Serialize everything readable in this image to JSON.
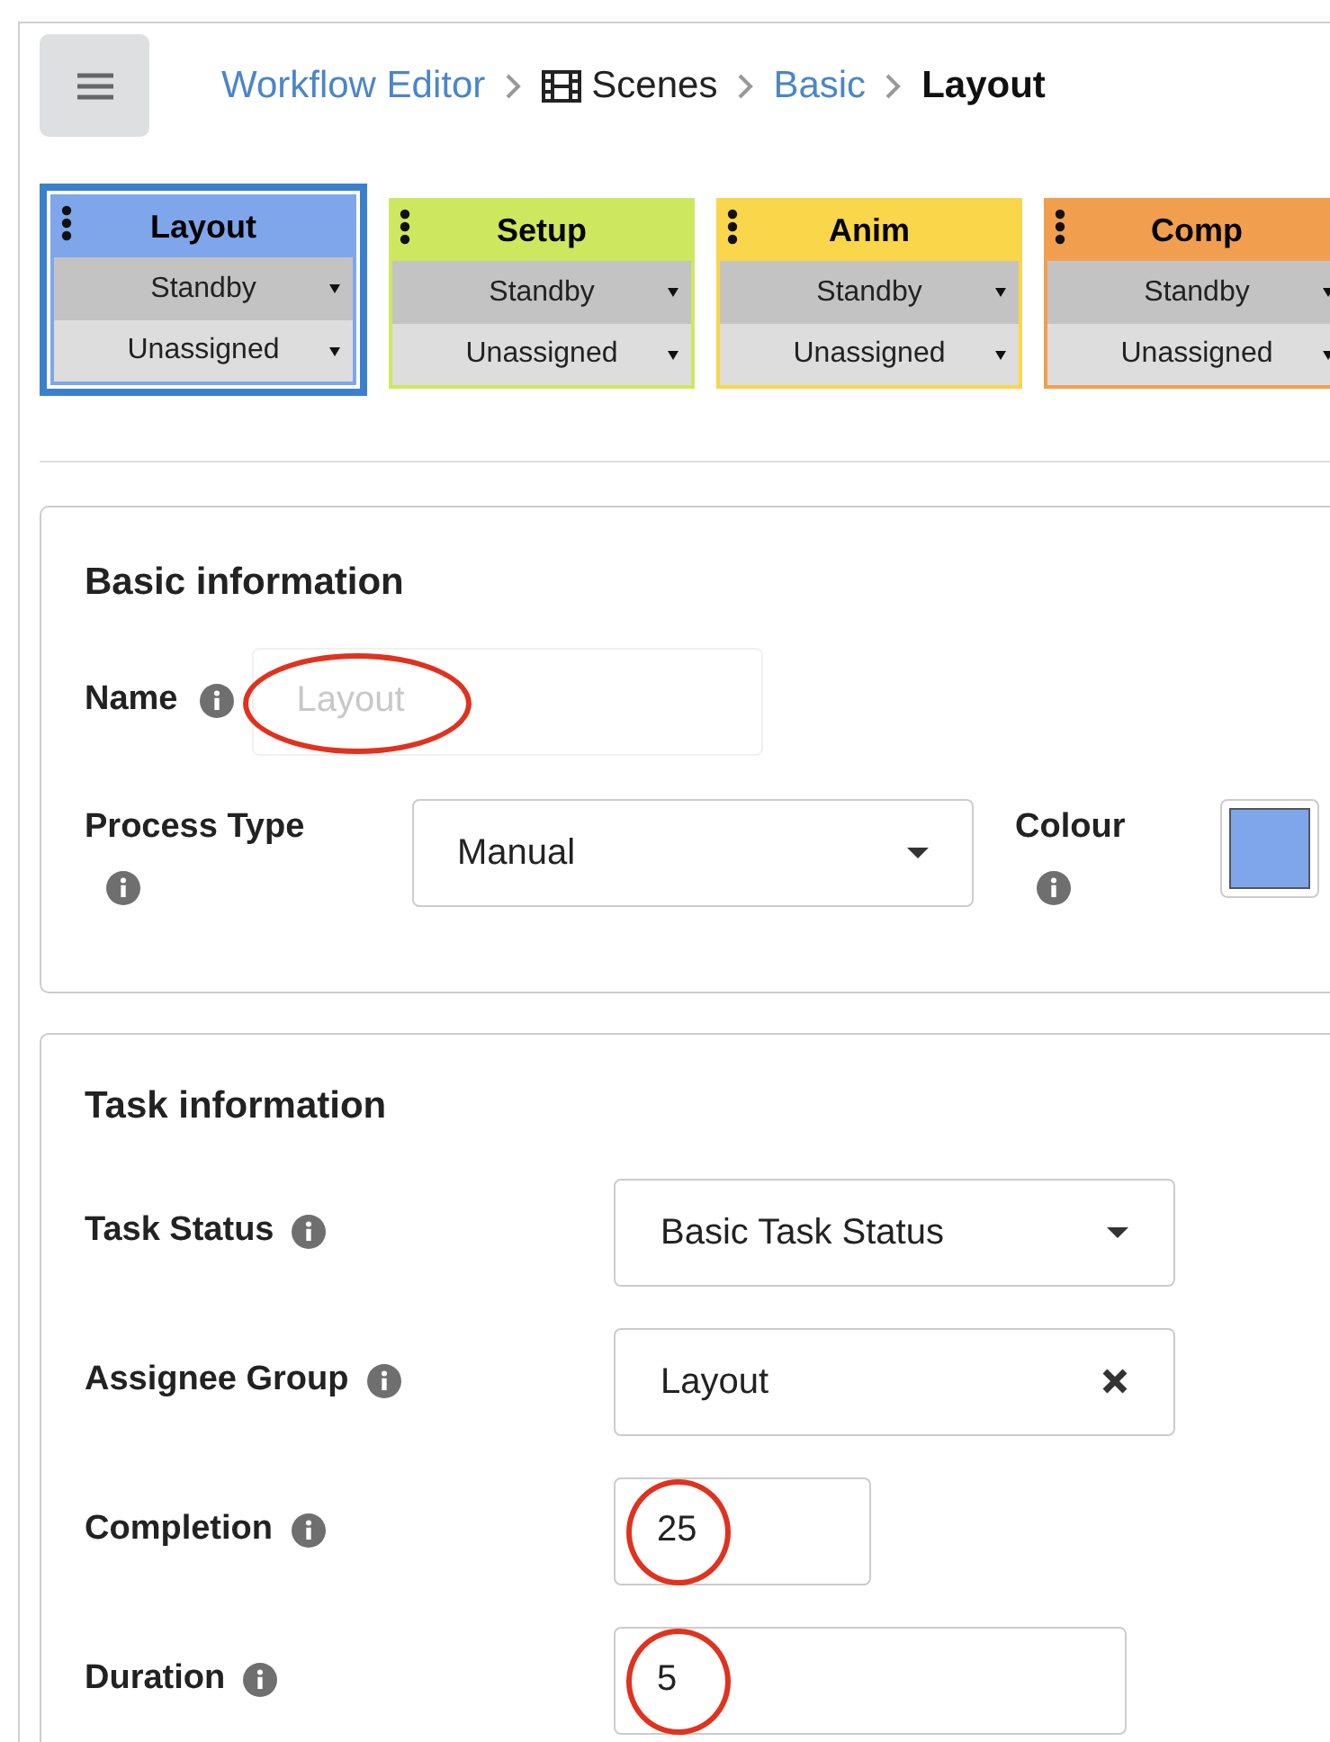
{
  "breadcrumb": [
    {
      "label": "Workflow Editor",
      "kind": "link"
    },
    {
      "label": "Scenes",
      "kind": "folder"
    },
    {
      "label": "Basic",
      "kind": "link"
    },
    {
      "label": "Layout",
      "kind": "current"
    }
  ],
  "processes": [
    {
      "title": "Layout",
      "color": "#7fa6ea",
      "selected": true,
      "status": "Standby",
      "assignee": "Unassigned"
    },
    {
      "title": "Setup",
      "color": "#cde85f",
      "selected": false,
      "status": "Standby",
      "assignee": "Unassigned"
    },
    {
      "title": "Anim",
      "color": "#f9d64a",
      "selected": false,
      "status": "Standby",
      "assignee": "Unassigned"
    },
    {
      "title": "Comp",
      "color": "#f19f4f",
      "selected": false,
      "status": "Standby",
      "assignee": "Unassigned"
    }
  ],
  "basic_information": {
    "title": "Basic information",
    "name": {
      "label": "Name",
      "placeholder": "Layout",
      "circled": true
    },
    "process_type": {
      "label": "Process Type",
      "value": "Manual"
    },
    "colour": {
      "label": "Colour",
      "color": "#7fa6ea"
    }
  },
  "task_information": {
    "title": "Task information",
    "fields": [
      {
        "label": "Task Status",
        "kind": "select",
        "value": "Basic Task Status",
        "circled": false
      },
      {
        "label": "Assignee Group",
        "kind": "clearable",
        "value": "Layout",
        "circled": false
      },
      {
        "label": "Completion",
        "kind": "number",
        "value": "25",
        "circled": true
      },
      {
        "label": "Duration",
        "kind": "number",
        "value": "5",
        "circled": true
      }
    ]
  }
}
